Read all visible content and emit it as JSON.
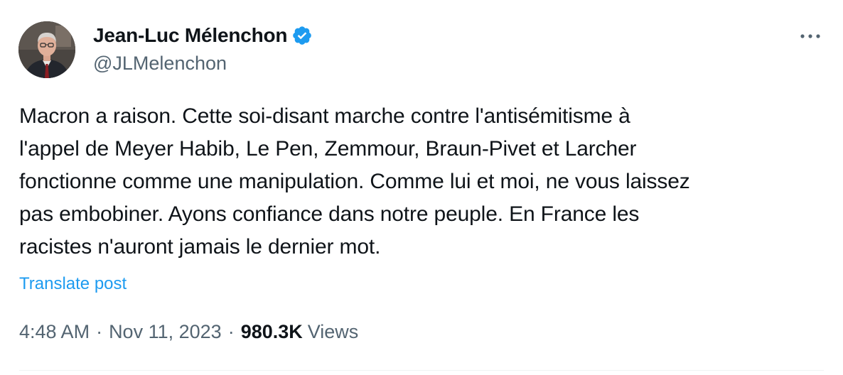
{
  "author": {
    "display_name": "Jean-Luc Mélenchon",
    "handle": "@JLMelenchon",
    "verified": true,
    "verified_badge_color": "#1d9bf0"
  },
  "post": {
    "text": "Macron a raison. Cette soi-disant marche contre l'antisémitisme à\nl'appel de Meyer Habib, Le Pen, Zemmour, Braun-Pivet et Larcher\nfonctionne comme une manipulation. Comme lui et moi, ne vous laissez\npas embobiner. Ayons confiance dans notre peuple. En France les\nracistes n'auront jamais le dernier mot.",
    "translate_label": "Translate post"
  },
  "meta": {
    "time": "4:48 AM",
    "separator": "·",
    "date": "Nov 11, 2023",
    "views_count": "980.3K",
    "views_label": "Views"
  },
  "icons": {
    "more": "more-horizontal-icon",
    "verified": "verified-badge-icon"
  },
  "colors": {
    "link": "#1d9bf0",
    "secondary_text": "#536471",
    "primary_text": "#0f1419"
  }
}
